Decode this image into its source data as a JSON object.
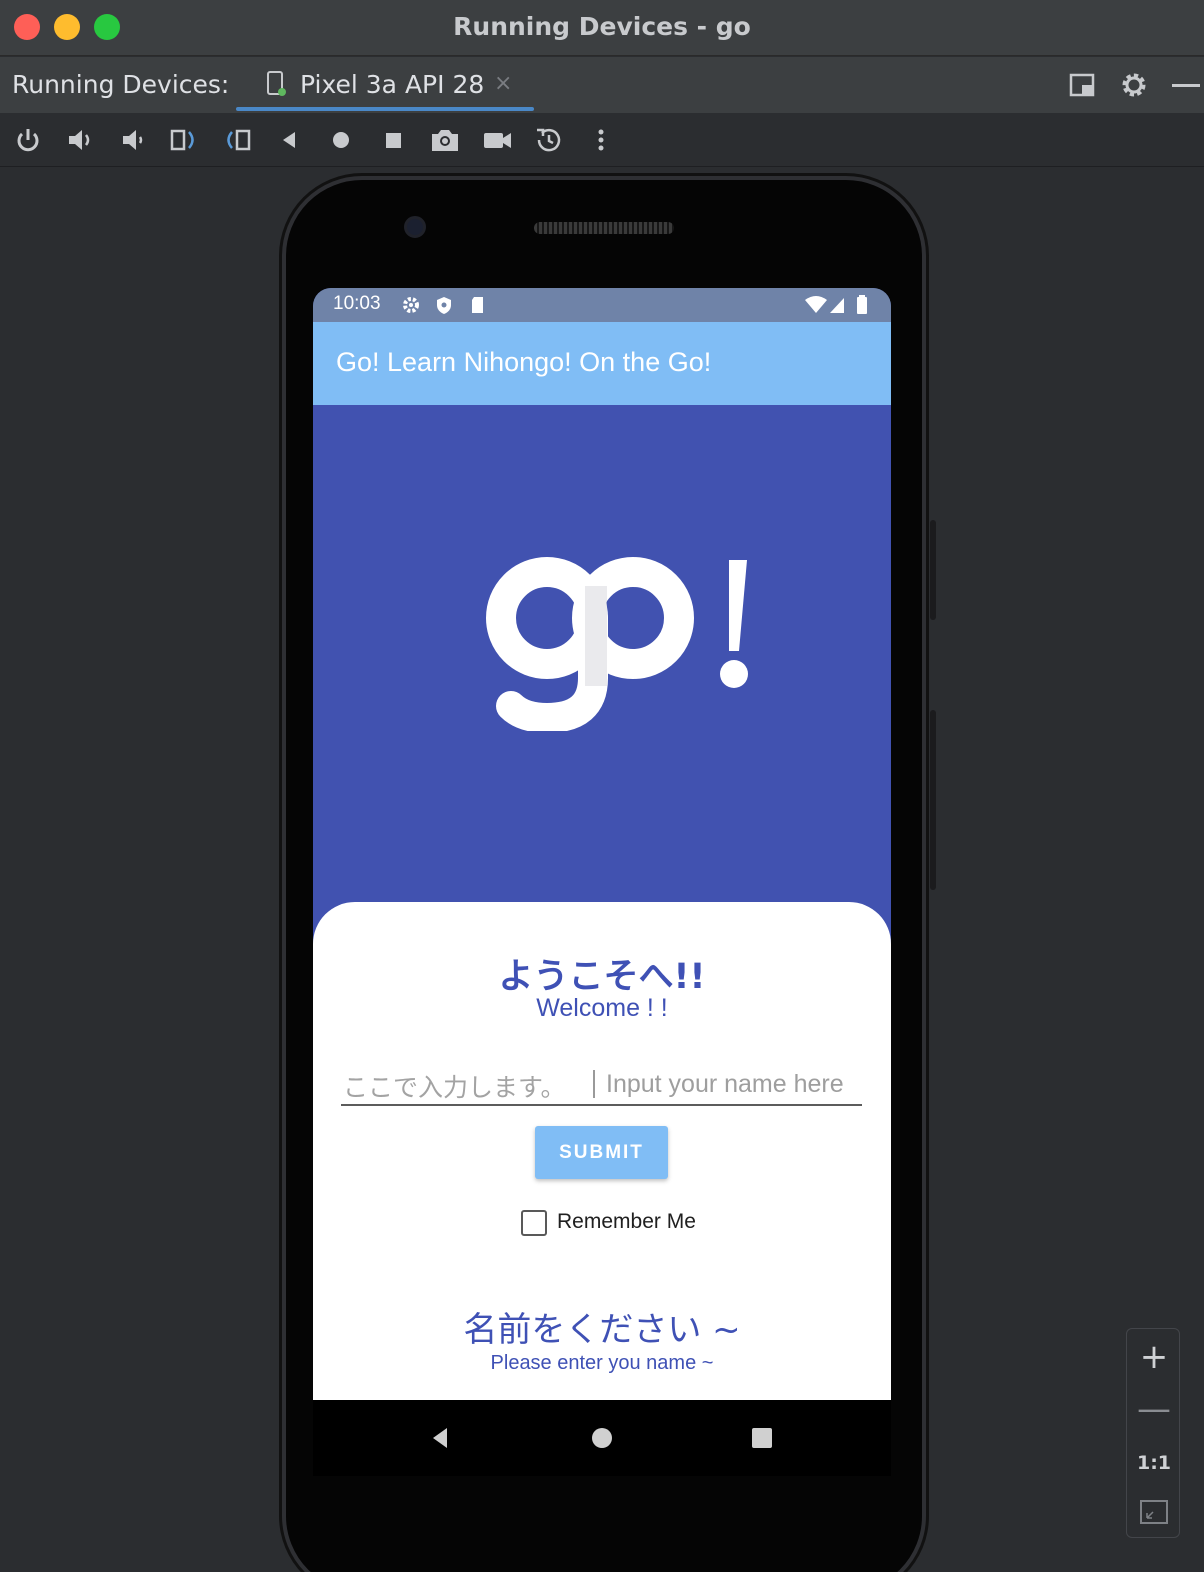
{
  "window": {
    "title": "Running Devices - go"
  },
  "tool_window": {
    "label": "Running Devices:",
    "device_tab": {
      "label": "Pixel 3a API 28",
      "close": "×"
    }
  },
  "toolbar": {
    "icons": [
      "power-icon",
      "volume-up-icon",
      "volume-down-icon",
      "rotate-left-icon",
      "rotate-right-icon",
      "back-icon",
      "home-icon",
      "overview-icon",
      "screenshot-icon",
      "screen-record-icon",
      "reset-icon",
      "more-icon"
    ]
  },
  "device": {
    "status_bar": {
      "time": "10:03"
    },
    "app_bar": {
      "title": "Go! Learn Nihongo! On the Go!"
    },
    "welcome": {
      "jp": "ようこそへ!!",
      "en": "Welcome ! !"
    },
    "name_input": {
      "placeholder_jp": "ここで入力します。",
      "placeholder_en": "Input your name here"
    },
    "submit": {
      "label": "SUBMIT"
    },
    "remember": {
      "label": "Remember Me",
      "checked": false
    },
    "prompt": {
      "jp": "名前をください ~",
      "en": "Please enter you name ~"
    }
  },
  "zoom": {
    "zoom_in": "+",
    "zoom_out": "—",
    "actual_size": "1:1"
  },
  "colors": {
    "screen_background": "#4152b0",
    "app_bar": "#80bdf5",
    "accent_text": "#3f51b5",
    "tab_underline": "#4a88c7"
  }
}
